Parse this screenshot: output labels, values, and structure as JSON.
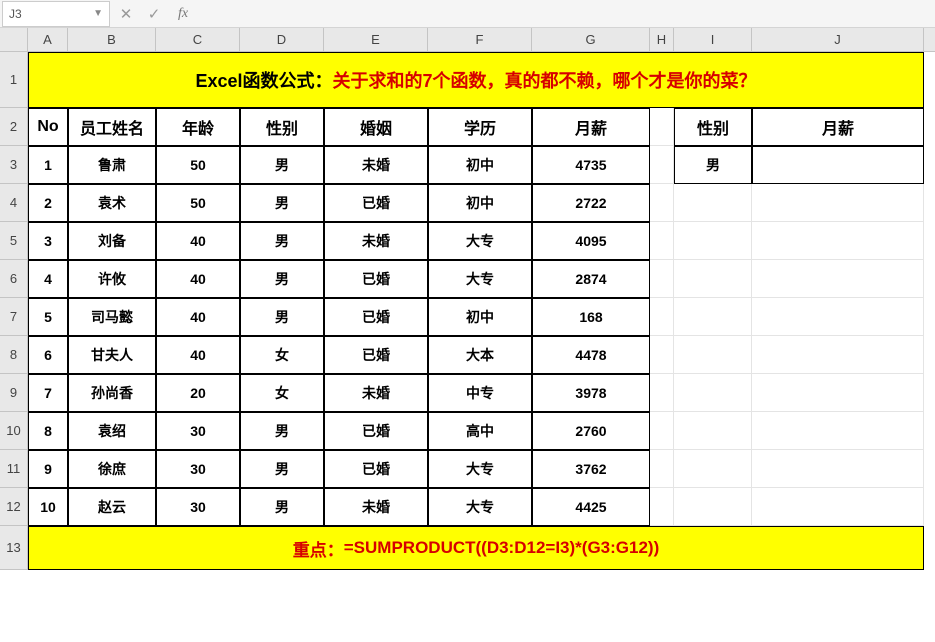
{
  "formula_bar": {
    "cell_ref": "J3"
  },
  "columns": [
    "A",
    "B",
    "C",
    "D",
    "E",
    "F",
    "G",
    "H",
    "I",
    "J"
  ],
  "row_numbers": [
    "1",
    "2",
    "3",
    "4",
    "5",
    "6",
    "7",
    "8",
    "9",
    "10",
    "11",
    "12",
    "13"
  ],
  "title": {
    "prefix": "Excel函数公式：",
    "main": "关于求和的7个函数，真的都不赖，哪个才是你的菜？"
  },
  "headers": {
    "no": "No",
    "name": "员工姓名",
    "age": "年龄",
    "gender": "性别",
    "marriage": "婚姻",
    "edu": "学历",
    "salary": "月薪"
  },
  "side_headers": {
    "gender": "性别",
    "salary": "月薪"
  },
  "side_value": {
    "gender": "男"
  },
  "rows": [
    {
      "no": "1",
      "name": "鲁肃",
      "age": "50",
      "gender": "男",
      "marriage": "未婚",
      "edu": "初中",
      "salary": "4735"
    },
    {
      "no": "2",
      "name": "袁术",
      "age": "50",
      "gender": "男",
      "marriage": "已婚",
      "edu": "初中",
      "salary": "2722"
    },
    {
      "no": "3",
      "name": "刘备",
      "age": "40",
      "gender": "男",
      "marriage": "未婚",
      "edu": "大专",
      "salary": "4095"
    },
    {
      "no": "4",
      "name": "许攸",
      "age": "40",
      "gender": "男",
      "marriage": "已婚",
      "edu": "大专",
      "salary": "2874"
    },
    {
      "no": "5",
      "name": "司马懿",
      "age": "40",
      "gender": "男",
      "marriage": "已婚",
      "edu": "初中",
      "salary": "168"
    },
    {
      "no": "6",
      "name": "甘夫人",
      "age": "40",
      "gender": "女",
      "marriage": "已婚",
      "edu": "大本",
      "salary": "4478"
    },
    {
      "no": "7",
      "name": "孙尚香",
      "age": "20",
      "gender": "女",
      "marriage": "未婚",
      "edu": "中专",
      "salary": "3978"
    },
    {
      "no": "8",
      "name": "袁绍",
      "age": "30",
      "gender": "男",
      "marriage": "已婚",
      "edu": "高中",
      "salary": "2760"
    },
    {
      "no": "9",
      "name": "徐庶",
      "age": "30",
      "gender": "男",
      "marriage": "已婚",
      "edu": "大专",
      "salary": "3762"
    },
    {
      "no": "10",
      "name": "赵云",
      "age": "30",
      "gender": "男",
      "marriage": "未婚",
      "edu": "大专",
      "salary": "4425"
    }
  ],
  "footer": {
    "label": "重点：",
    "formula": "=SUMPRODUCT((D3:D12=I3)*(G3:G12))"
  }
}
